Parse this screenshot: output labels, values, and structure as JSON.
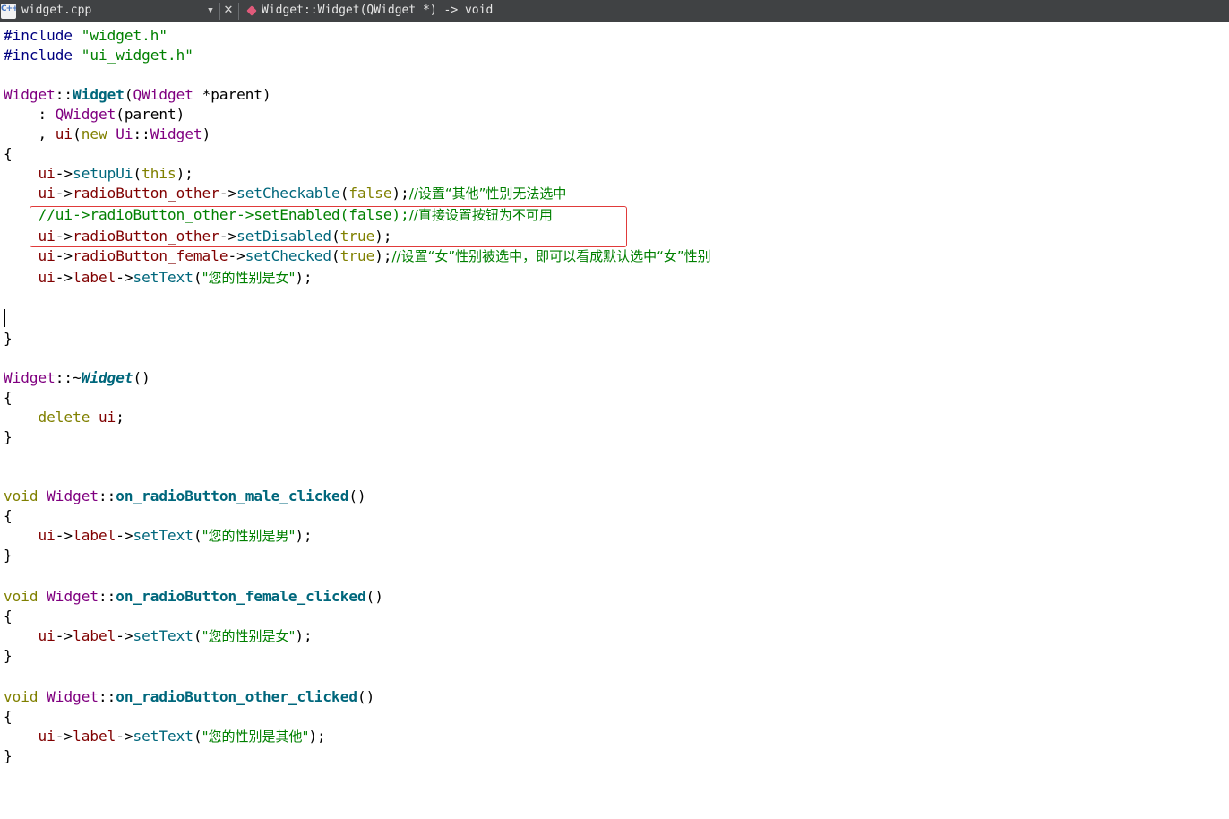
{
  "toolbar": {
    "file_icon_text": "C++",
    "file_name": "widget.cpp",
    "dropdown_glyph": "▼",
    "close_glyph": "✕",
    "symbol": "Widget::Widget(QWidget *) -> void"
  },
  "code": {
    "l1": {
      "a": "#include ",
      "b": "\"widget.h\""
    },
    "l2": {
      "a": "#include ",
      "b": "\"ui_widget.h\""
    },
    "l4": {
      "a": "Widget",
      "b": "::",
      "c": "Widget",
      "d": "(",
      "e": "QWidget",
      "f": " *parent)"
    },
    "l5": {
      "a": "    : ",
      "b": "QWidget",
      "c": "(parent)"
    },
    "l6": {
      "a": "    , ",
      "b": "ui",
      "c": "(",
      "d": "new",
      "e": " ",
      "f": "Ui",
      "g": "::",
      "h": "Widget",
      "i": ")"
    },
    "l7": {
      "a": "{"
    },
    "l8": {
      "a": "    ",
      "b": "ui",
      "c": "->",
      "d": "setupUi",
      "e": "(",
      "f": "this",
      "g": ");"
    },
    "l9": {
      "a": "    ",
      "b": "ui",
      "c": "->",
      "d": "radioButton_other",
      "e": "->",
      "f": "setCheckable",
      "g": "(",
      "h": "false",
      "i": ");",
      "j": "//设置“其他”性别无法选中"
    },
    "l10": {
      "a": "    ",
      "b": "//ui->radioButton_other->setEnabled(false);",
      "c": "//直接设置按钮为不可用"
    },
    "l11": {
      "a": "    ",
      "b": "ui",
      "c": "->",
      "d": "radioButton_other",
      "e": "->",
      "f": "setDisabled",
      "g": "(",
      "h": "true",
      "i": ");"
    },
    "l12": {
      "a": "    ",
      "b": "ui",
      "c": "->",
      "d": "radioButton_female",
      "e": "->",
      "f": "setChecked",
      "g": "(",
      "h": "true",
      "i": ");",
      "j": "//设置“女”性别被选中，即可以看成默认选中“女”性别"
    },
    "l13": {
      "a": "    ",
      "b": "ui",
      "c": "->",
      "d": "label",
      "e": "->",
      "f": "setText",
      "g": "(",
      "h": "\"您的性别是女\"",
      "i": ");"
    },
    "l16": {
      "a": "}"
    },
    "l18": {
      "a": "Widget",
      "b": "::~",
      "c": "Widget",
      "d": "()"
    },
    "l19": {
      "a": "{"
    },
    "l20": {
      "a": "    ",
      "b": "delete",
      "c": " ",
      "d": "ui",
      "e": ";"
    },
    "l21": {
      "a": "}"
    },
    "l24": {
      "a": "void",
      "b": " ",
      "c": "Widget",
      "d": "::",
      "e": "on_radioButton_male_clicked",
      "f": "()"
    },
    "l25": {
      "a": "{"
    },
    "l26": {
      "a": "    ",
      "b": "ui",
      "c": "->",
      "d": "label",
      "e": "->",
      "f": "setText",
      "g": "(",
      "h": "\"您的性别是男\"",
      "i": ");"
    },
    "l27": {
      "a": "}"
    },
    "l29": {
      "a": "void",
      "b": " ",
      "c": "Widget",
      "d": "::",
      "e": "on_radioButton_female_clicked",
      "f": "()"
    },
    "l30": {
      "a": "{"
    },
    "l31": {
      "a": "    ",
      "b": "ui",
      "c": "->",
      "d": "label",
      "e": "->",
      "f": "setText",
      "g": "(",
      "h": "\"您的性别是女\"",
      "i": ");"
    },
    "l32": {
      "a": "}"
    },
    "l34": {
      "a": "void",
      "b": " ",
      "c": "Widget",
      "d": "::",
      "e": "on_radioButton_other_clicked",
      "f": "()"
    },
    "l35": {
      "a": "{"
    },
    "l36": {
      "a": "    ",
      "b": "ui",
      "c": "->",
      "d": "label",
      "e": "->",
      "f": "setText",
      "g": "(",
      "h": "\"您的性别是其他\"",
      "i": ");"
    },
    "l37": {
      "a": "}"
    }
  },
  "colors": {
    "keyword": "#808000",
    "class": "#800080",
    "function": "#00677c",
    "member": "#800000",
    "string": "#008000",
    "comment": "#008000",
    "preprocessor": "#000080",
    "highlight_border": "#e03a3a",
    "toolbar_bg": "#404244"
  }
}
